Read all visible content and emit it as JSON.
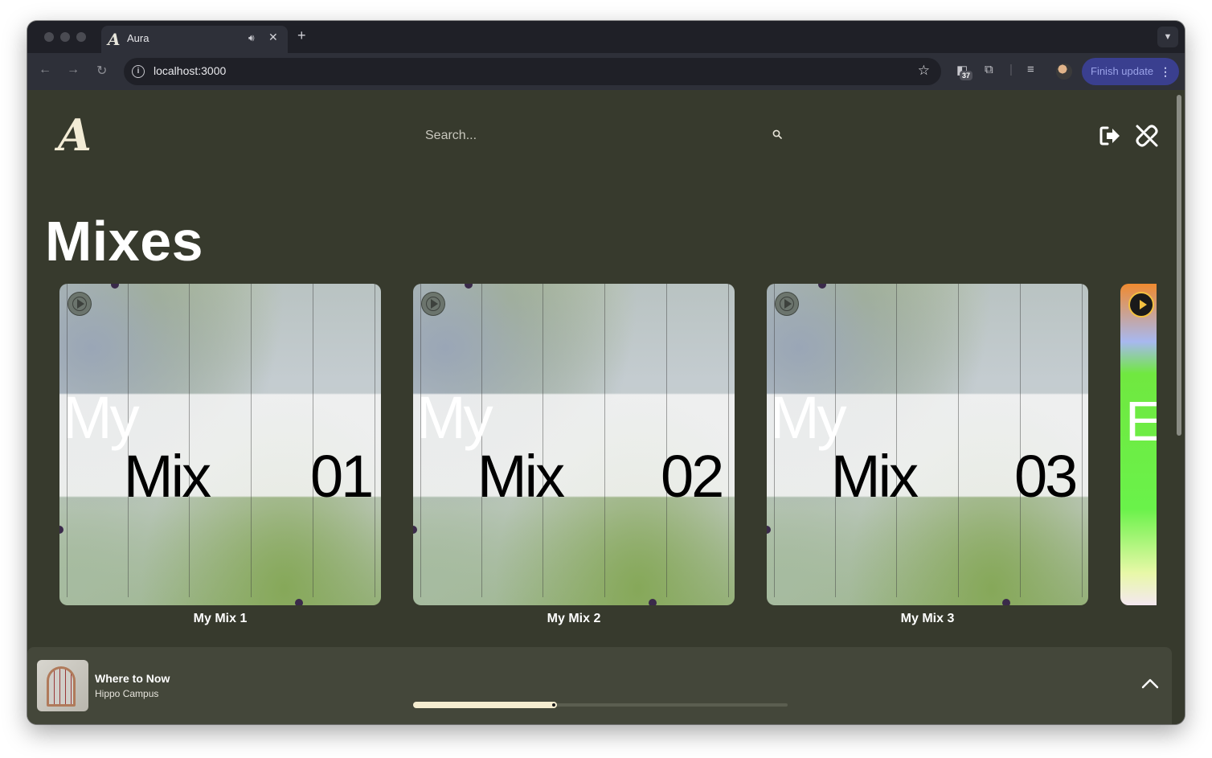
{
  "browser": {
    "tab": {
      "title": "Aura",
      "favicon": "A"
    },
    "address": "localhost:3000",
    "extension_badge": "37",
    "finish_update_label": "Finish update"
  },
  "app": {
    "logo": "A",
    "search": {
      "placeholder": "Search..."
    },
    "heading": "Mixes",
    "mixes": [
      {
        "label": "My Mix 1",
        "cover_words": [
          "My",
          "Mix",
          "01"
        ]
      },
      {
        "label": "My Mix 2",
        "cover_words": [
          "My",
          "Mix",
          "02"
        ]
      },
      {
        "label": "My Mix 3",
        "cover_words": [
          "My",
          "Mix",
          "03"
        ]
      }
    ],
    "partial_card_letter": "E"
  },
  "player": {
    "title": "Where to Now",
    "artist": "Hippo Campus",
    "progress": 0.38
  },
  "colors": {
    "page_background": "#373a2d",
    "player_background": "#44473a",
    "accent_cream": "#f5edd0",
    "browser_chrome": "#1f2027"
  }
}
